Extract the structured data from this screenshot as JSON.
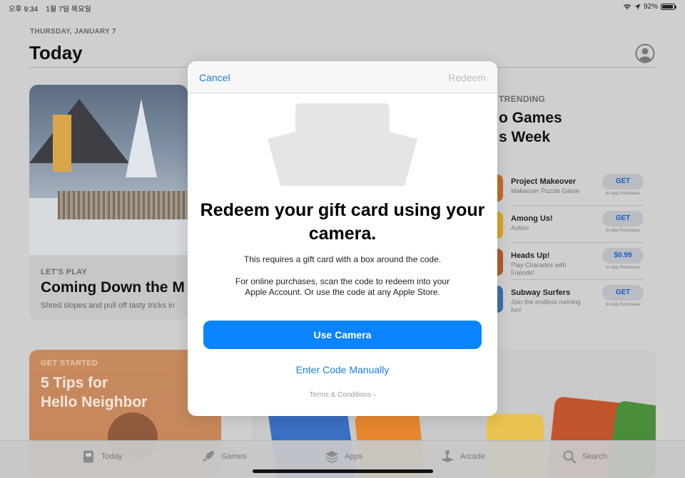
{
  "status_bar": {
    "time": "오후 9:34",
    "date": "1월 7일 목요일",
    "battery": "92%",
    "battery_level": 0.92,
    "icons": [
      "wifi-icon",
      "location-icon",
      "battery-icon"
    ]
  },
  "header": {
    "date": "THURSDAY, JANUARY 7",
    "title": "Today",
    "account_icon": "account-icon"
  },
  "cards": {
    "lets_play": {
      "label": "LET'S PLAY",
      "headline": "Coming Down the M",
      "sub": "Shred slopes and pull off tasty tricks in"
    },
    "trending": {
      "label": "TRENDING",
      "headline_line1": "o Games",
      "headline_line2": "s Week",
      "apps": [
        {
          "name": "Project Makeover",
          "genre": "Makeover Puzzle Game",
          "button": "GET",
          "iap": "In-App Purchases",
          "color": "#c46b2c"
        },
        {
          "name": "Among Us!",
          "genre": "Action",
          "button": "GET",
          "iap": "In-App Purchases",
          "color": "#d8a42b"
        },
        {
          "name": "Heads Up!",
          "genre": "Play Charades with Friends!",
          "button": "$0.99",
          "iap": "In-App Purchases",
          "color": "#b35a2c"
        },
        {
          "name": "Subway Surfers",
          "genre": "Join the endless running fun!",
          "button": "GET",
          "iap": "In-App Purchases",
          "color": "#3e6fb0"
        }
      ]
    },
    "get_started": {
      "label": "GET STARTED",
      "headline_line1": "5 Tips for",
      "headline_line2": "Hello Neighbor"
    }
  },
  "modal": {
    "cancel": "Cancel",
    "redeem": "Redeem",
    "title_line1": "Redeem your gift card using your",
    "title_line2": "camera.",
    "desc1": "This requires a gift card with a box around the code.",
    "desc2_line1": "For online purchases, scan the code to redeem into your",
    "desc2_line2": "Apple Account. Or use the code at any Apple Store.",
    "primary_button": "Use Camera",
    "secondary_link": "Enter Code Manually",
    "terms": "Terms & Conditions ›"
  },
  "tab_bar": {
    "tabs": [
      {
        "label": "Today",
        "icon": "today-icon"
      },
      {
        "label": "Games",
        "icon": "rocket-icon"
      },
      {
        "label": "Apps",
        "icon": "layers-icon"
      },
      {
        "label": "Arcade",
        "icon": "joystick-icon"
      },
      {
        "label": "Search",
        "icon": "search-icon"
      }
    ]
  },
  "colors": {
    "accent": "#0a84ff",
    "link": "#1a7fe6",
    "disabled": "#bdbdbd"
  }
}
